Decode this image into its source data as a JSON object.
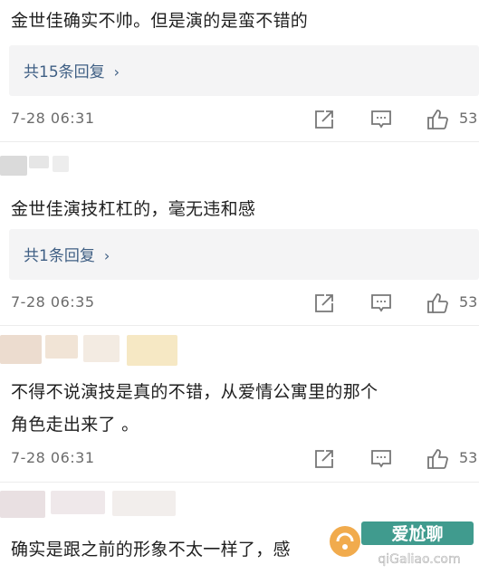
{
  "comments": [
    {
      "text": "金世佳确实不帅。但是演的是蛮不错的",
      "replies_label": "共15条回复",
      "timestamp": "7-28 06:31",
      "likes": "53"
    },
    {
      "text": "金世佳演技杠杠的，毫无违和感",
      "replies_label": "共1条回复",
      "timestamp": "7-28 06:35",
      "likes": "53"
    },
    {
      "text_line1": "不得不说演技是真的不错，从爱情公寓里的那个",
      "text_line2": "角色走出来了 。",
      "timestamp": "7-28 06:31",
      "likes": "53"
    },
    {
      "text": "确实是跟之前的形象不太一样了，感"
    }
  ],
  "reply_chevron": "›",
  "icons": {
    "share": "share-icon",
    "comment": "comment-icon",
    "like": "thumbs-up-icon"
  },
  "watermark": {
    "title": "爱尬聊",
    "url": "qiGaliao.com"
  },
  "colors": {
    "reply_link": "#3f5f84",
    "reply_bg": "#f4f4f5",
    "meta_text": "#6b6b6b",
    "icon_stroke": "#777777"
  }
}
